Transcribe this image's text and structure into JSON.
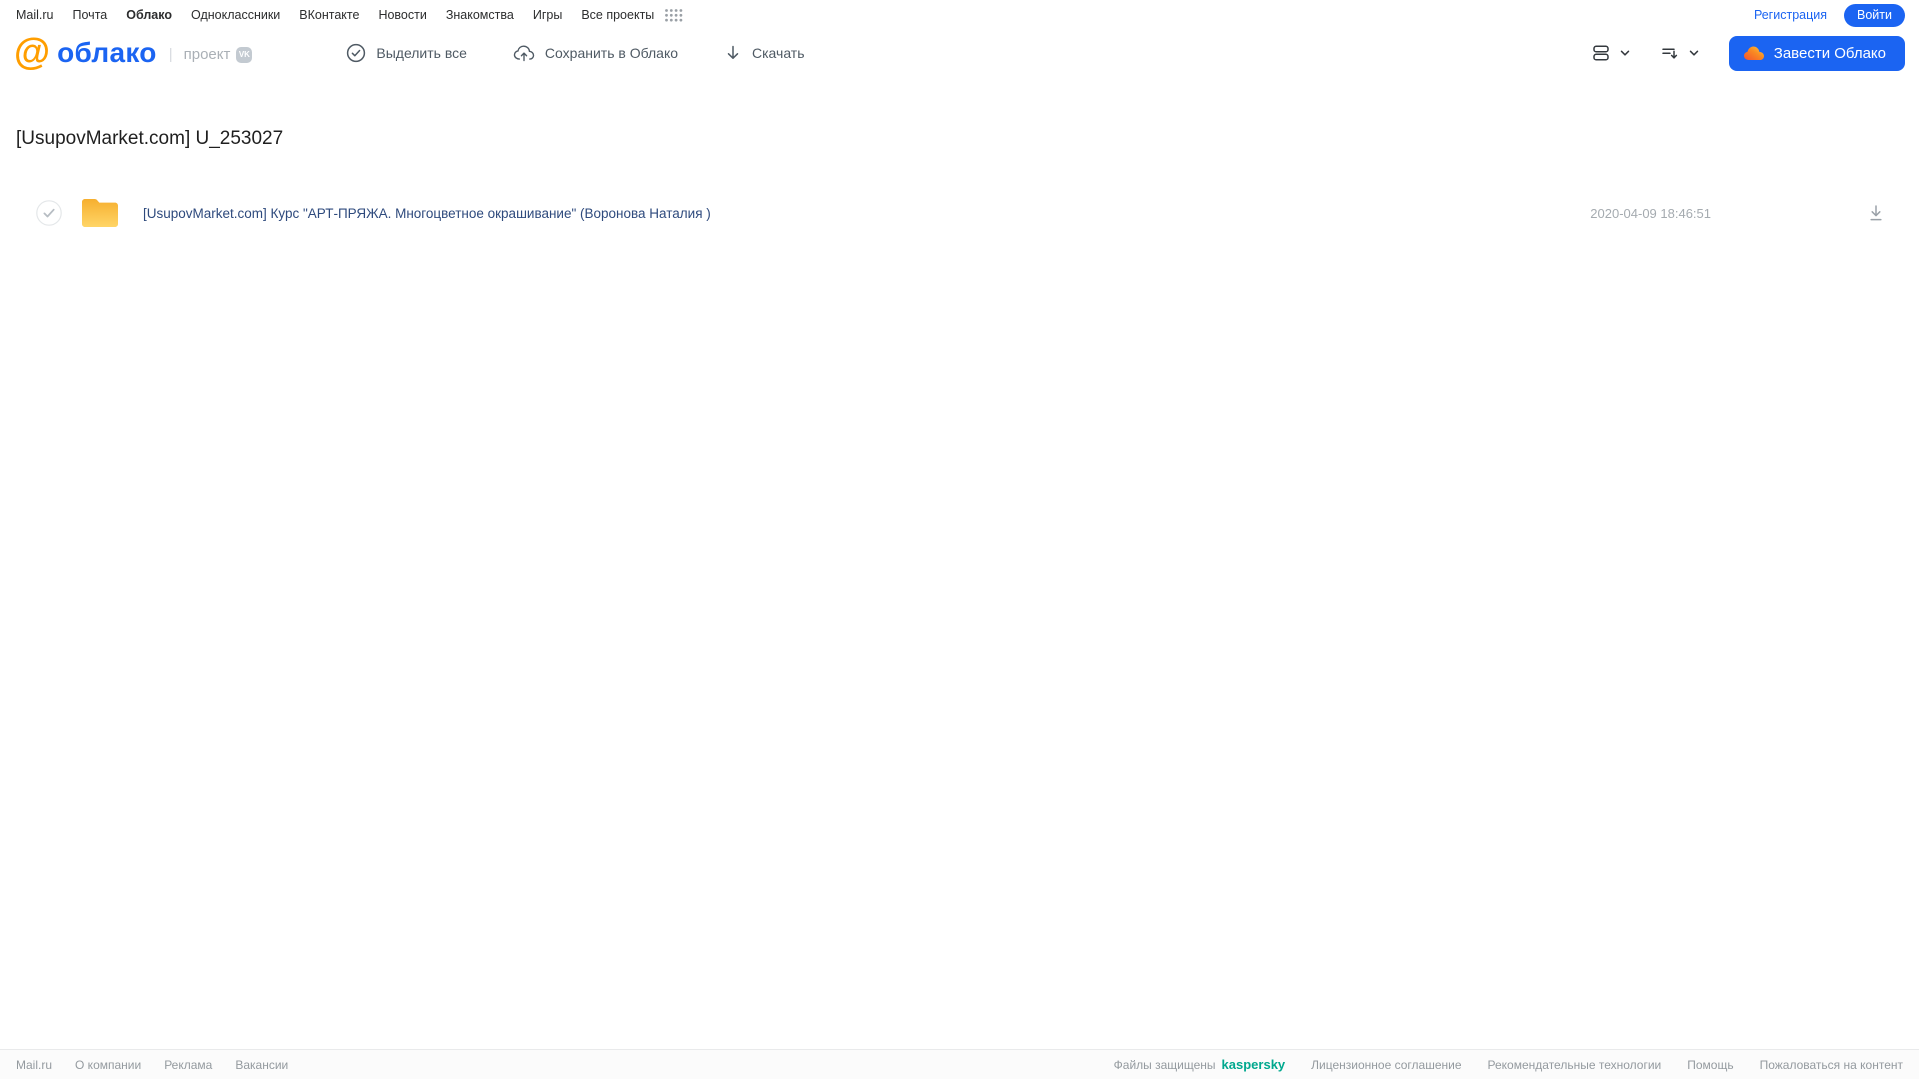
{
  "topnav": {
    "items": [
      {
        "label": "Mail.ru"
      },
      {
        "label": "Почта"
      },
      {
        "label": "Облако",
        "active": true
      },
      {
        "label": "Одноклассники"
      },
      {
        "label": "ВКонтакте"
      },
      {
        "label": "Новости"
      },
      {
        "label": "Знакомства"
      },
      {
        "label": "Игры"
      },
      {
        "label": "Все проекты"
      }
    ],
    "registration_label": "Регистрация",
    "login_label": "Войти"
  },
  "header": {
    "logo_at": "@",
    "logo_word": "облако",
    "project_label": "проект",
    "vk_badge": "VK",
    "toolbar": {
      "select_all": "Выделить все",
      "save_to_cloud": "Сохранить в Облако",
      "download": "Скачать"
    },
    "get_cloud_label": "Завести Облако"
  },
  "content": {
    "title": "[UsupovMarket.com] U_253027",
    "files": [
      {
        "type": "folder",
        "name": "[UsupovMarket.com] Курс \"АРТ-ПРЯЖА. Многоцветное окрашивание\" (Воронова Наталия )",
        "date": "2020-04-09 18:46:51"
      }
    ]
  },
  "footer": {
    "left_links": [
      "Mail.ru",
      "О компании",
      "Реклама",
      "Вакансии"
    ],
    "kaspersky_prefix": "Файлы защищены",
    "kaspersky_brand": "kaspersky",
    "right_links": [
      "Лицензионное соглашение",
      "Рекомендательные технологии",
      "Помощь",
      "Пожаловаться на контент"
    ]
  },
  "colors": {
    "accent_blue": "#1B64F2",
    "logo_orange": "#FF9E00",
    "folder_amber": "#F7B733",
    "kaspersky_teal": "#00A88E"
  }
}
